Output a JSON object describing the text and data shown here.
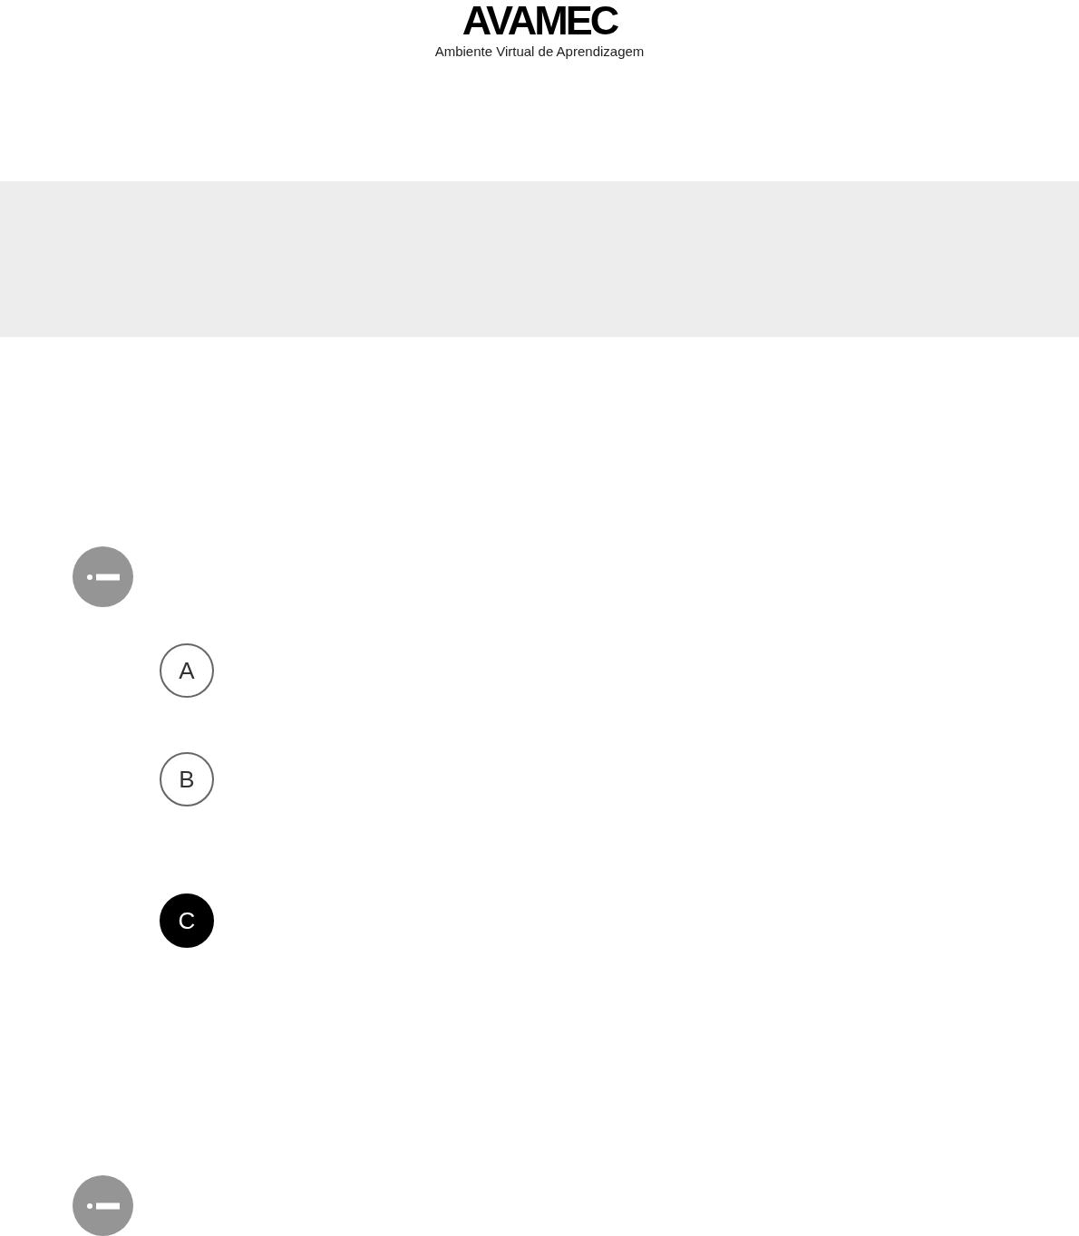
{
  "header": {
    "logo": "AVAMEC",
    "subtitle": "Ambiente Virtual de Aprendizagem"
  },
  "questions": [
    {
      "kind": "multiple_choice",
      "options": [
        {
          "letter": "A",
          "selected": false
        },
        {
          "letter": "B",
          "selected": false
        },
        {
          "letter": "C",
          "selected": true
        }
      ]
    },
    {
      "kind": "multiple_choice"
    }
  ]
}
